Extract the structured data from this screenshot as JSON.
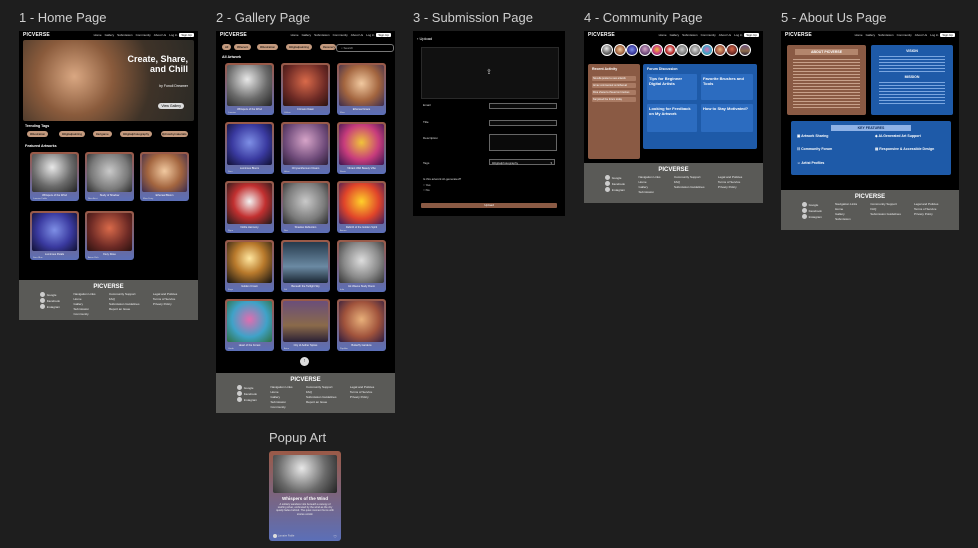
{
  "frame_labels": {
    "home": "1 - Home Page",
    "gallery": "2 - Gallery Page",
    "submission": "3 - Submission Page",
    "community": "4 - Community Page",
    "about": "5 - About Us Page",
    "popup": "Popup Art"
  },
  "brand": "PICVERSE",
  "nav": {
    "links": [
      "Home",
      "Gallery",
      "Submission",
      "Community",
      "About Us"
    ],
    "login": "Log in",
    "signup": "Sign Up"
  },
  "home": {
    "hero_title": "Create, Share, and Chill",
    "hero_sub": "by Fonoli Dreamer",
    "hero_button": "View Gallery",
    "trending_label": "Trending Tags",
    "tags": [
      "#illustration",
      "#digitalpainting",
      "#artgame",
      "#digitalphotography",
      "#photobymaterials"
    ],
    "featured_label": "Featured Artworks",
    "featured": [
      {
        "title": "Whispers of the Wind",
        "user": "Lumaire Fable"
      },
      {
        "title": "Study of Shadow",
        "user": "Noir Artist"
      },
      {
        "title": "Ethereal Bloom",
        "user": "Mina Fairy"
      },
      {
        "title": "Luminous Petals",
        "user": "Sera Blue"
      },
      {
        "title": "Fiery Rose",
        "user": "Anton Rich"
      }
    ]
  },
  "gallery": {
    "filters": [
      "All",
      "#Recent",
      "#illustration",
      "#digitalpainting",
      "#scenery"
    ],
    "search_placeholder": "Search",
    "section_label": "All Artwork",
    "cards": [
      {
        "title": "Whispers of the Wind",
        "user": "Lumaire"
      },
      {
        "title": "Crimson Dawn",
        "user": "Vellum"
      },
      {
        "title": "Ethereal Grace",
        "user": "Mina"
      },
      {
        "title": "Luminous Bloom",
        "user": "Sera"
      },
      {
        "title": "Chrysanthemum Dream",
        "user": "Hikari"
      },
      {
        "title": "Vibrant Wild Beauty Vibe",
        "user": "Rania"
      },
      {
        "title": "Noble Harmony",
        "user": "Ryuu"
      },
      {
        "title": "Shadow Reflection",
        "user": "Noir"
      },
      {
        "title": "Rebirth of the Golden Spirit",
        "user": "Aurum"
      },
      {
        "title": "Golden Crown",
        "user": "Kaya"
      },
      {
        "title": "Beneath the Twilight Sky",
        "user": "Sol"
      },
      {
        "title": "Ink Waves Study Room",
        "user": "Inka"
      },
      {
        "title": "Heart of the Forest",
        "user": "Verde"
      },
      {
        "title": "City of Aether Spires",
        "user": "Astra"
      },
      {
        "title": "Butterfly Gardens",
        "user": "Papillon"
      }
    ]
  },
  "submission": {
    "back_label": "Upload",
    "fields": {
      "email": "Email",
      "title": "Title",
      "description": "Description",
      "tags": "Tags",
      "tags_value": "#digitalphotography"
    },
    "ai_question": "Is this artwork AI-generated?",
    "ai_yes": "Yes",
    "ai_no": "No",
    "submit": "Upload"
  },
  "community": {
    "recent_title": "Recent Activity",
    "recent_items": [
      "Novella posted a new artwork",
      "Arnav commented on Ethereal",
      "Dina shared a thread on brushes",
      "Kai joined the forum today"
    ],
    "forum_title": "Forum Discussion",
    "threads": [
      "Tips for Beginner Digital Artists",
      "Favorite Brushes and Tools",
      "Looking for Feedback on My Artwork",
      "How to Stay Motivated?"
    ]
  },
  "about": {
    "about_title": "ABOUT PICVERSE",
    "vision_title": "VISION",
    "mission_title": "MISSION",
    "features_title": "KEY FEATURES",
    "features": [
      "Artwork Sharing",
      "AI-Generated Art Support",
      "Community Forum",
      "Responsive & Accessible Design",
      "Artist Profiles"
    ]
  },
  "footer": {
    "title": "PICVERSE",
    "socials": [
      "Google",
      "Facebook",
      "Instagram"
    ],
    "col_heads": [
      "Navigation Links",
      "Community Support",
      "Legal and Policies"
    ],
    "nav_links": [
      "Home",
      "Gallery",
      "Submission",
      "Community",
      "About Us"
    ],
    "support_links": [
      "FAQ",
      "Submission Guidelines",
      "Report an Issue"
    ],
    "legal_links": [
      "Terms of Service",
      "Privacy Policy"
    ]
  },
  "popup": {
    "title": "Whispers of the Wind",
    "description": "A solitary wanderer sits beneath a canopy of swirling silver, embraced by the wind as the city quietly fades behind. The quiet moment hums with stories untold.",
    "user": "Lumaire Fable"
  }
}
